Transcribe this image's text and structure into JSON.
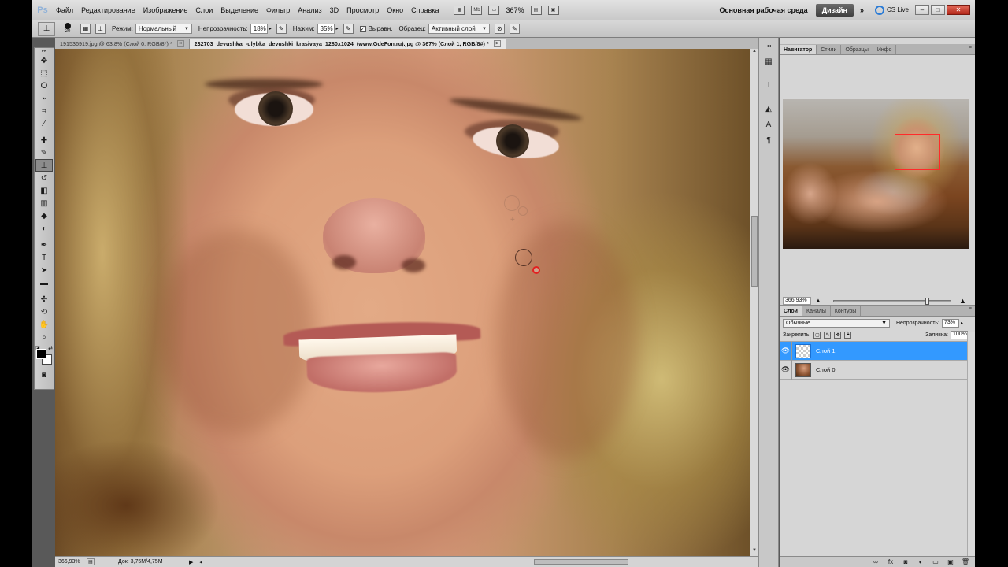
{
  "menubar": {
    "logo": "Ps",
    "items": [
      "Файл",
      "Редактирование",
      "Изображение",
      "Слои",
      "Выделение",
      "Фильтр",
      "Анализ",
      "3D",
      "Просмотр",
      "Окно",
      "Справка"
    ],
    "zoom": "367%",
    "workspace": "Основная рабочая среда",
    "design_button": "Дизайн",
    "more": "»",
    "cslive": "CS Live",
    "win_min": "–",
    "win_max": "□",
    "win_close": "✕"
  },
  "options": {
    "brush_size": "20",
    "mode_label": "Режим:",
    "mode_value": "Нормальный",
    "opacity_label": "Непрозрачность:",
    "opacity_value": "18%",
    "flow_label": "Нажим:",
    "flow_value": "35%",
    "aligned_label": "Выравн.",
    "sample_label": "Образец:",
    "sample_value": "Активный слой"
  },
  "tabs": [
    {
      "title": "191536919.jpg @ 63,8% (Слой 0, RGB/8*) *",
      "close": "×"
    },
    {
      "title": "232703_devushka_-ulybka_devushki_krasivaya_1280x1024_(www.GdeFon.ru).jpg @ 367% (Слой 1, RGB/8#) *",
      "close": "×"
    }
  ],
  "toolbox": {
    "icons": [
      "move-icon",
      "marquee-icon",
      "lasso-icon",
      "quick-select-icon",
      "crop-icon",
      "eyedropper-icon",
      "healing-brush-icon",
      "brush-icon",
      "clone-stamp-icon",
      "history-brush-icon",
      "eraser-icon",
      "gradient-icon",
      "blur-icon",
      "dodge-icon",
      "pen-icon",
      "type-icon",
      "path-select-icon",
      "shape-icon",
      "3d-rotate-icon",
      "3d-camera-icon",
      "hand-icon",
      "zoom-icon"
    ],
    "selected": "clone-stamp-icon"
  },
  "status": {
    "zoom": "366,93%",
    "doc": "Док: 3,75M/4,75M"
  },
  "navigator": {
    "tabs": [
      "Навигатор",
      "Стили",
      "Образцы",
      "Инфо"
    ],
    "zoom": "366,93%",
    "view_fraction": 0.8
  },
  "layers": {
    "tabs": [
      "Слои",
      "Каналы",
      "Контуры"
    ],
    "blend_mode": "Обычные",
    "opacity_label": "Непрозрачность:",
    "opacity_value": "73%",
    "lock_label": "Закрепить:",
    "fill_label": "Заливка:",
    "fill_value": "100%",
    "items": [
      {
        "name": "Слой 1",
        "selected": true
      },
      {
        "name": "Слой 0",
        "selected": false
      }
    ]
  },
  "colors": {
    "foreground": "#000000",
    "background": "#ffffff",
    "selection": "#3399ff",
    "navigator_box": "#ff2a2a"
  }
}
